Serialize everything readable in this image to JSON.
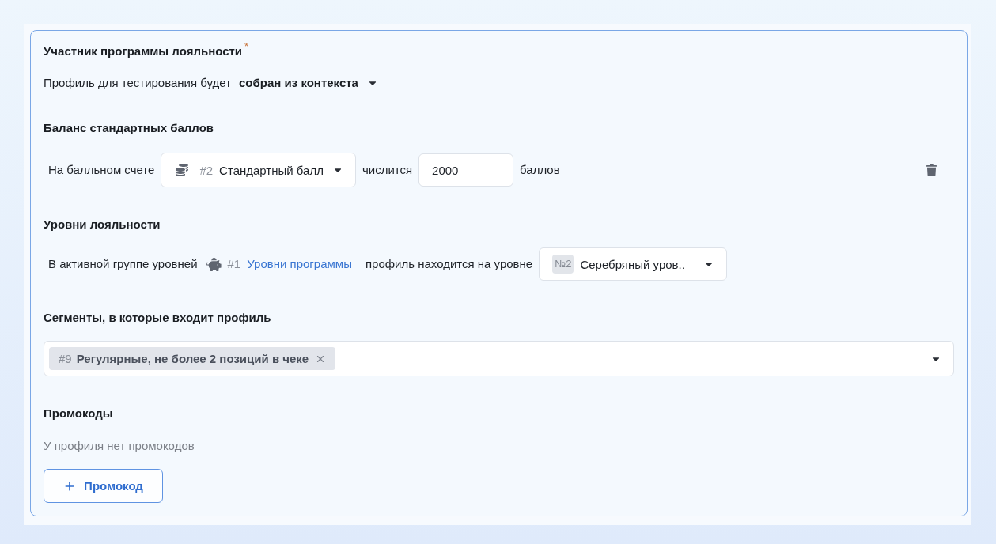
{
  "participant": {
    "title": "Участник программы лояльности",
    "required_mark": "*",
    "profile_label": "Профиль для тестирования будет",
    "profile_source": "собран из контекста"
  },
  "balance": {
    "title": "Баланс стандартных баллов",
    "rows": [
      {
        "prefix": "На балльном счете",
        "currency_number": "#2",
        "currency_name": "Стандартный балл",
        "middle": "числится",
        "amount": "2000",
        "suffix": "баллов"
      }
    ]
  },
  "levels": {
    "title": "Уровни лояльности",
    "prefix": "В активной группе уровней",
    "group_number": "#1",
    "group_link": "Уровни программы",
    "middle": "профиль находится на уровне",
    "level_number": "№2",
    "level_name": "Серебряный уров.."
  },
  "segments": {
    "title": "Сегменты, в которые входит профиль",
    "chips": [
      {
        "number": "#9",
        "name": "Регулярные, не более 2 позиций в чеке"
      }
    ]
  },
  "promocodes": {
    "title": "Промокоды",
    "empty_text": "У профиля нет промокодов",
    "add_button": "Промокод"
  }
}
